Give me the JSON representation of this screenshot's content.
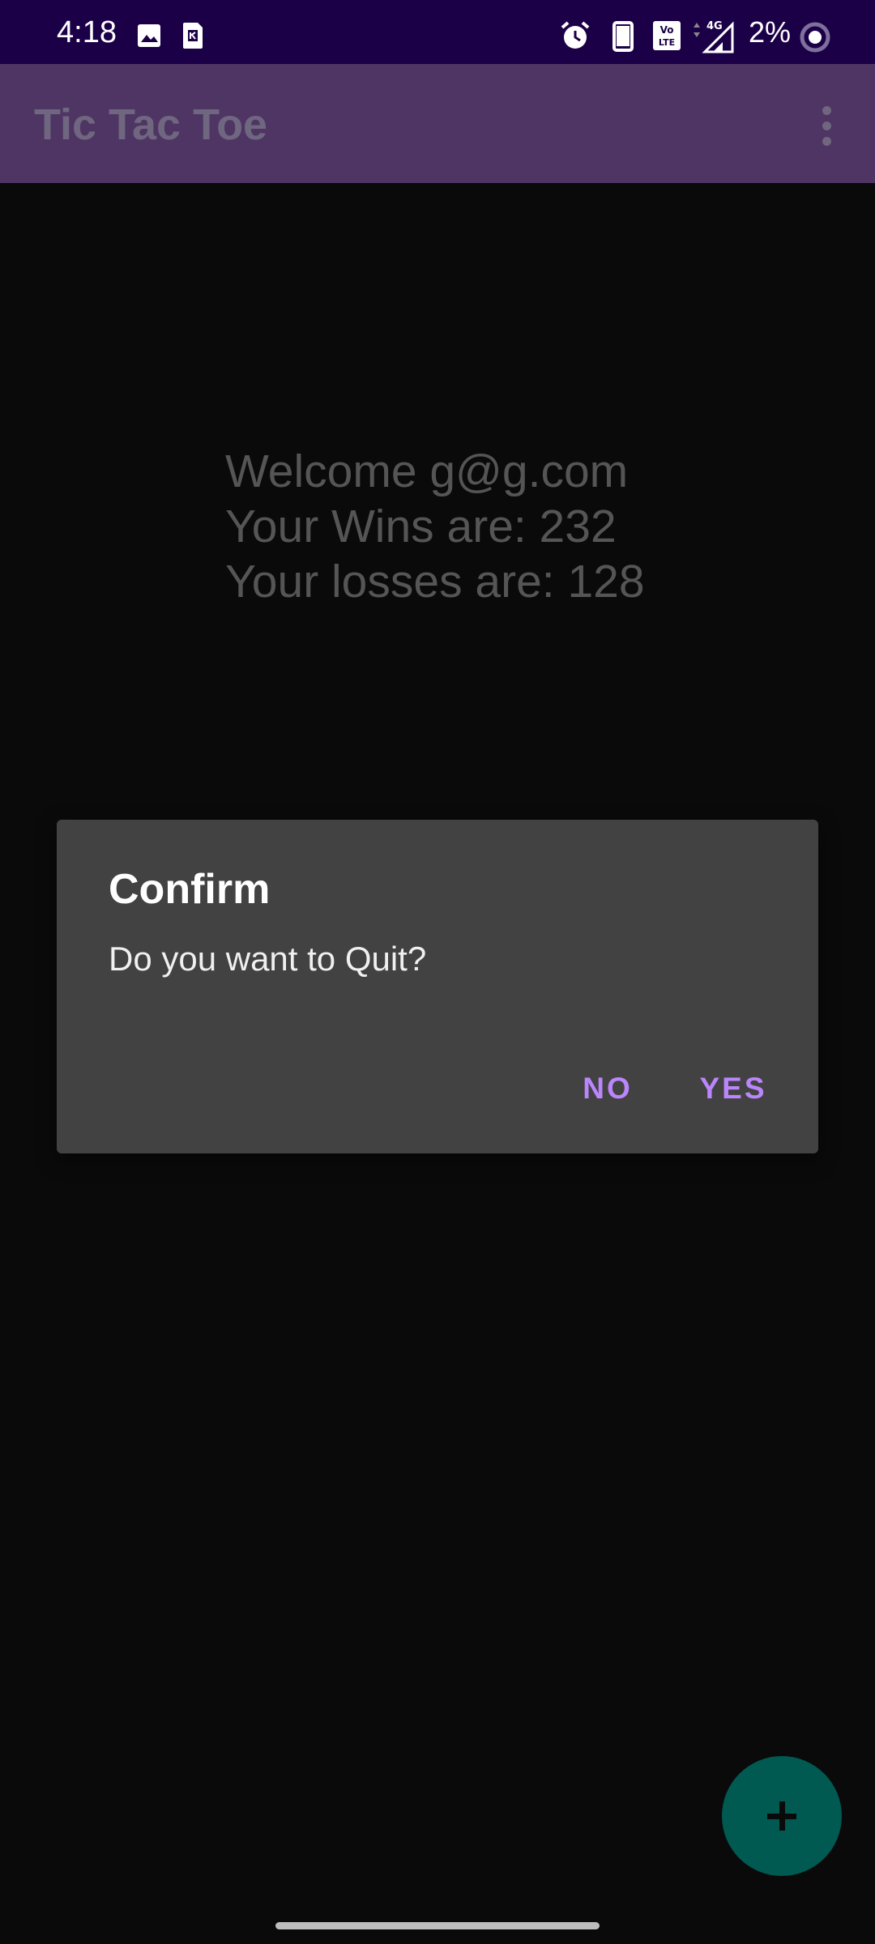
{
  "status_bar": {
    "time": "4:18",
    "battery": "2%",
    "icons": [
      "image-icon",
      "sim-card-icon",
      "alarm-icon",
      "phone-icon",
      "volte-icon",
      "signal-4g-icon",
      "battery-ring-icon"
    ]
  },
  "app_bar": {
    "title": "Tic Tac Toe"
  },
  "main": {
    "welcome_line": "Welcome g@g.com",
    "wins_line": "Your Wins are: 232",
    "losses_line": "Your losses are: 128"
  },
  "dialog": {
    "title": "Confirm",
    "message": "Do you want to Quit?",
    "no_label": "NO",
    "yes_label": "YES"
  },
  "colors": {
    "status_bar_bg": "#1b0047",
    "app_bar_bg": "#4f3563",
    "dialog_bg": "#424242",
    "dialog_button": "#bb86fc",
    "fab_bg": "#005a52"
  }
}
